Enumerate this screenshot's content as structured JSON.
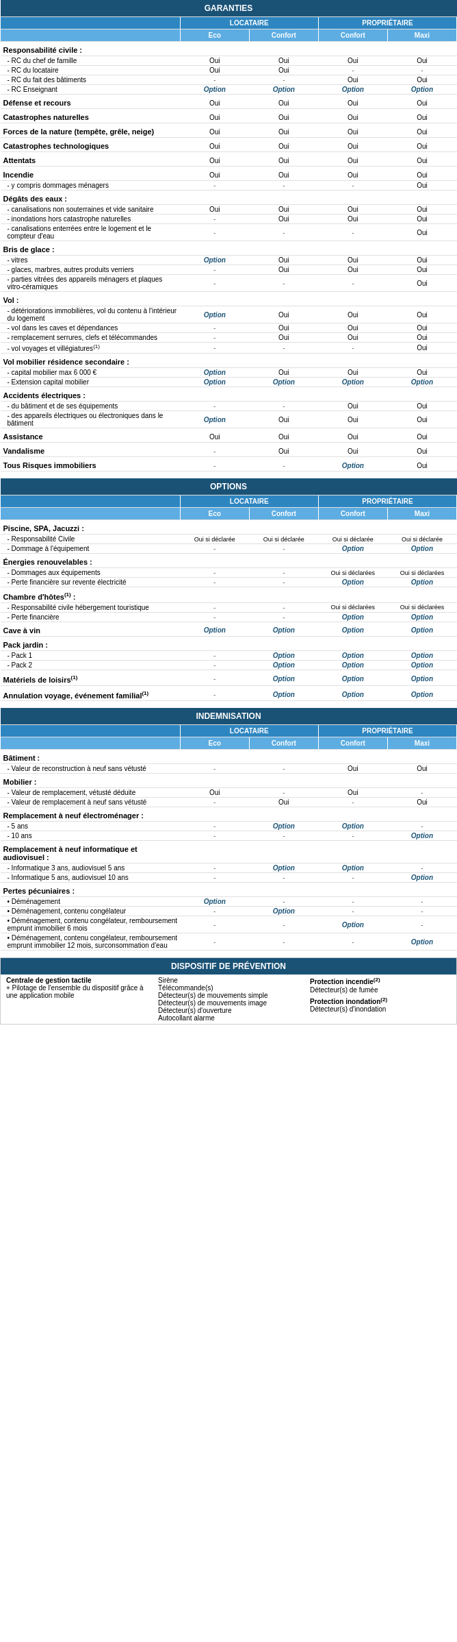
{
  "tables": {
    "garanties": {
      "title": "GARANTIES",
      "col_headers": [
        {
          "label": "LOCATAIRE",
          "span": 2
        },
        {
          "label": "PROPRIÉTAIRE",
          "span": 2
        }
      ],
      "col_subs": [
        "Eco",
        "Confort",
        "Confort",
        "Maxi"
      ],
      "rows": [
        {
          "label": "Responsabilité civile :",
          "bold": true,
          "type": "category"
        },
        {
          "label": "- RC du chef de famille",
          "type": "sub",
          "values": [
            "Oui",
            "Oui",
            "Oui",
            "Oui"
          ]
        },
        {
          "label": "- RC du locataire",
          "type": "sub",
          "values": [
            "Oui",
            "Oui",
            "-",
            "-"
          ]
        },
        {
          "label": "- RC du fait des bâtiments",
          "type": "sub",
          "values": [
            "-",
            "-",
            "Oui",
            "Oui"
          ]
        },
        {
          "label": "- RC Enseignant",
          "type": "sub",
          "values": [
            "Option",
            "Option",
            "Option",
            "Option"
          ]
        },
        {
          "label": "Défense et recours",
          "bold": true,
          "type": "category",
          "values": [
            "Oui",
            "Oui",
            "Oui",
            "Oui"
          ]
        },
        {
          "label": "Catastrophes naturelles",
          "bold": true,
          "type": "category",
          "values": [
            "Oui",
            "Oui",
            "Oui",
            "Oui"
          ]
        },
        {
          "label": "Forces de la nature (tempête, grêle, neige)",
          "bold": true,
          "type": "category",
          "values": [
            "Oui",
            "Oui",
            "Oui",
            "Oui"
          ]
        },
        {
          "label": "Catastrophes technologiques",
          "bold": true,
          "type": "category",
          "values": [
            "Oui",
            "Oui",
            "Oui",
            "Oui"
          ]
        },
        {
          "label": "Attentats",
          "bold": true,
          "type": "category",
          "values": [
            "Oui",
            "Oui",
            "Oui",
            "Oui"
          ]
        },
        {
          "label": "Incendie",
          "bold": true,
          "type": "category",
          "values": [
            "Oui",
            "Oui",
            "Oui",
            "Oui"
          ]
        },
        {
          "label": "- y compris dommages ménagers",
          "type": "sub",
          "values": [
            "-",
            "-",
            "-",
            "Oui"
          ]
        },
        {
          "label": "Dégâts des eaux :",
          "bold": true,
          "type": "category"
        },
        {
          "label": "- canalisations non souterraines et vide sanitaire",
          "type": "sub",
          "values": [
            "Oui",
            "Oui",
            "Oui",
            "Oui"
          ]
        },
        {
          "label": "- inondations hors catastrophe naturelles",
          "type": "sub",
          "values": [
            "-",
            "Oui",
            "Oui",
            "Oui"
          ]
        },
        {
          "label": "- canalisations enterrées entre le logement et le compteur d'eau",
          "type": "sub",
          "values": [
            "-",
            "-",
            "-",
            "Oui"
          ]
        },
        {
          "label": "Bris de glace :",
          "bold": true,
          "type": "category"
        },
        {
          "label": "- vitres",
          "type": "sub",
          "values": [
            "Option",
            "Oui",
            "Oui",
            "Oui"
          ]
        },
        {
          "label": "- glaces, marbres, autres produits verriers",
          "type": "sub",
          "values": [
            "-",
            "Oui",
            "Oui",
            "Oui"
          ]
        },
        {
          "label": "- parties vitrées des appareils ménagers et plaques vitro-céramiques",
          "type": "sub",
          "values": [
            "-",
            "-",
            "-",
            "Oui"
          ]
        },
        {
          "label": "Vol :",
          "bold": true,
          "type": "category"
        },
        {
          "label": "- détériorations immobilières, vol du contenu à l'intérieur du logement",
          "type": "sub",
          "values": [
            "Option",
            "Oui",
            "Oui",
            "Oui"
          ]
        },
        {
          "label": "- vol dans les caves et dépendances",
          "type": "sub",
          "values": [
            "-",
            "Oui",
            "Oui",
            "Oui"
          ]
        },
        {
          "label": "- remplacement serrures, clefs et télécommandes",
          "type": "sub",
          "values": [
            "-",
            "Oui",
            "Oui",
            "Oui"
          ]
        },
        {
          "label": "- vol voyages et villégiatures(1)",
          "type": "sub",
          "values": [
            "-",
            "-",
            "-",
            "Oui"
          ]
        },
        {
          "label": "Vol mobilier résidence secondaire :",
          "bold": true,
          "type": "category"
        },
        {
          "label": "- capital mobilier max 6 000 €",
          "type": "sub",
          "values": [
            "Option",
            "Oui",
            "Oui",
            "Oui"
          ]
        },
        {
          "label": "- Extension capital mobilier",
          "type": "sub",
          "values": [
            "Option",
            "Option",
            "Option",
            "Option"
          ]
        },
        {
          "label": "Accidents électriques :",
          "bold": true,
          "type": "category"
        },
        {
          "label": "- du bâtiment et de ses équipements",
          "type": "sub",
          "values": [
            "-",
            "-",
            "Oui",
            "Oui"
          ]
        },
        {
          "label": "- des appareils électriques ou électroniques dans le bâtiment",
          "type": "sub",
          "values": [
            "Option",
            "Oui",
            "Oui",
            "Oui"
          ]
        },
        {
          "label": "Assistance",
          "bold": true,
          "type": "category",
          "values": [
            "Oui",
            "Oui",
            "Oui",
            "Oui"
          ]
        },
        {
          "label": "Vandalisme",
          "bold": true,
          "type": "category",
          "values": [
            "-",
            "Oui",
            "Oui",
            "Oui"
          ]
        },
        {
          "label": "Tous Risques immobiliers",
          "bold": true,
          "type": "category",
          "values": [
            "-",
            "-",
            "Option",
            "Oui"
          ]
        }
      ]
    },
    "options": {
      "title": "OPTIONS",
      "col_headers": [
        {
          "label": "LOCATAIRE",
          "span": 2
        },
        {
          "label": "PROPRIÉTAIRE",
          "span": 2
        }
      ],
      "col_subs": [
        "Eco",
        "Confort",
        "Confort",
        "Maxi"
      ],
      "rows": [
        {
          "label": "Piscine, SPA, Jacuzzi :",
          "bold": true,
          "type": "category"
        },
        {
          "label": "- Responsabilité Civile",
          "type": "sub",
          "values": [
            "Oui si déclarée",
            "Oui si déclarée",
            "Oui si déclarée",
            "Oui si déclarée"
          ]
        },
        {
          "label": "- Dommage à l'équipement",
          "type": "sub",
          "values": [
            "-",
            "-",
            "Option",
            "Option"
          ]
        },
        {
          "label": "Énergies renouvelables :",
          "bold": true,
          "type": "category"
        },
        {
          "label": "- Dommages aux équipements",
          "type": "sub",
          "values": [
            "-",
            "-",
            "Oui si déclarées",
            "Oui si déclarées"
          ]
        },
        {
          "label": "- Perte financière sur revente électricité",
          "type": "sub",
          "values": [
            "-",
            "-",
            "Option",
            "Option"
          ]
        },
        {
          "label": "Chambre d'hôtes(1) :",
          "bold": true,
          "type": "category"
        },
        {
          "label": "- Responsabilité civile hébergement touristique",
          "type": "sub",
          "values": [
            "-",
            "-",
            "Oui si déclarées",
            "Oui si déclarées"
          ]
        },
        {
          "label": "- Perte financière",
          "type": "sub",
          "values": [
            "-",
            "-",
            "Option",
            "Option"
          ]
        },
        {
          "label": "Cave à vin",
          "bold": true,
          "type": "category",
          "values": [
            "Option",
            "Option",
            "Option",
            "Option"
          ]
        },
        {
          "label": "Pack jardin :",
          "bold": true,
          "type": "category"
        },
        {
          "label": "- Pack 1",
          "type": "sub",
          "values": [
            "-",
            "Option",
            "Option",
            "Option"
          ]
        },
        {
          "label": "- Pack 2",
          "type": "sub",
          "values": [
            "-",
            "Option",
            "Option",
            "Option"
          ]
        },
        {
          "label": "Matériels de loisirs(1)",
          "bold": true,
          "type": "category",
          "values": [
            "-",
            "Option",
            "Option",
            "Option"
          ]
        },
        {
          "label": "Annulation voyage, événement familial(1)",
          "bold": true,
          "type": "category",
          "values": [
            "-",
            "Option",
            "Option",
            "Option"
          ]
        }
      ]
    },
    "indemnisation": {
      "title": "INDEMNISATION",
      "col_headers": [
        {
          "label": "LOCATAIRE",
          "span": 2
        },
        {
          "label": "PROPRIÉTAIRE",
          "span": 2
        }
      ],
      "col_subs": [
        "Eco",
        "Confort",
        "Confort",
        "Maxi"
      ],
      "rows": [
        {
          "label": "Bâtiment :",
          "bold": true,
          "type": "category"
        },
        {
          "label": "- Valeur de reconstruction à neuf sans vétusté",
          "type": "sub",
          "values": [
            "-",
            "-",
            "Oui",
            "Oui"
          ]
        },
        {
          "label": "Mobilier :",
          "bold": true,
          "type": "category"
        },
        {
          "label": "- Valeur de remplacement, vétusté déduite",
          "type": "sub",
          "values": [
            "Oui",
            "-",
            "Oui",
            "-"
          ]
        },
        {
          "label": "- Valeur de remplacement à neuf sans vétusté",
          "type": "sub",
          "values": [
            "-",
            "Oui",
            "-",
            "Oui"
          ]
        },
        {
          "label": "Remplacement à neuf électroménager :",
          "bold": true,
          "type": "category"
        },
        {
          "label": "- 5 ans",
          "type": "sub",
          "values": [
            "-",
            "Option",
            "Option",
            "-"
          ]
        },
        {
          "label": "- 10 ans",
          "type": "sub",
          "values": [
            "-",
            "-",
            "-",
            "Option"
          ]
        },
        {
          "label": "Remplacement à neuf informatique et audiovisuel :",
          "bold": true,
          "type": "category"
        },
        {
          "label": "- Informatique 3 ans, audiovisuel 5 ans",
          "type": "sub",
          "values": [
            "-",
            "Option",
            "Option",
            "-"
          ]
        },
        {
          "label": "- Informatique 5 ans, audiovisuel 10 ans",
          "type": "sub",
          "values": [
            "-",
            "-",
            "-",
            "Option"
          ]
        },
        {
          "label": "Pertes pécuniaires :",
          "bold": true,
          "type": "category"
        },
        {
          "label": "• Déménagement",
          "type": "sub",
          "values": [
            "Option",
            "-",
            "-",
            "-"
          ]
        },
        {
          "label": "• Déménagement, contenu congélateur",
          "type": "sub",
          "values": [
            "-",
            "Option",
            "-",
            "-"
          ]
        },
        {
          "label": "• Déménagement, contenu congélateur, remboursement emprunt immobilier 6 mois",
          "type": "sub",
          "values": [
            "-",
            "-",
            "Option",
            "-"
          ]
        },
        {
          "label": "• Déménagement, contenu congélateur, remboursement emprunt immobilier 12 mois, surconsommation d'eau",
          "type": "sub",
          "values": [
            "-",
            "-",
            "-",
            "Option"
          ]
        }
      ]
    }
  },
  "prevention": {
    "title": "DISPOSITIF DE PRÉVENTION",
    "col1": {
      "heading": "Centrale de gestion tactile",
      "text": "+ Pilotage de l'ensemble du dispositif grâce à une application mobile"
    },
    "col2": {
      "items": [
        "Sirène",
        "Télécommande(s)",
        "Détecteur(s) de mouvements simple",
        "Détecteur(s) de mouvements image",
        "Détecteur(s) d'ouverture",
        "Autocollant alarme"
      ]
    },
    "col3": {
      "heading1": "Protection incendie(2)",
      "items1": [
        "Détecteur(s) de fumée"
      ],
      "heading2": "Protection inondation(2)",
      "items2": [
        "Détecteur(s) d'inondation"
      ]
    }
  }
}
